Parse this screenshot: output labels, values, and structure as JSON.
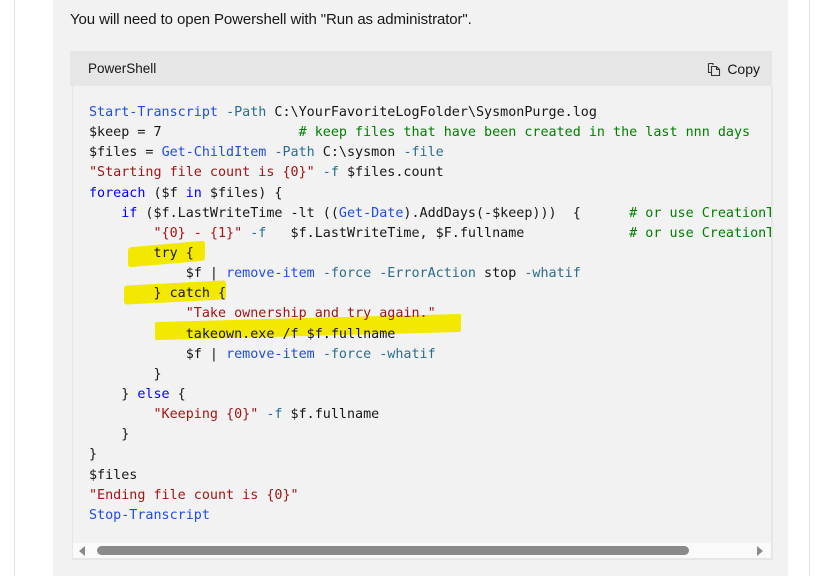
{
  "intro_text": "You will need to open Powershell with \"Run as administrator\".",
  "code_block": {
    "language": "PowerShell",
    "copy_label": "Copy",
    "copy_icon": "copy-icon",
    "lines": [
      [
        [
          "cmd",
          "Start-Transcript"
        ],
        [
          "plain",
          " "
        ],
        [
          "param",
          "-Path"
        ],
        [
          "plain",
          " C:\\YourFavoriteLogFolder\\SysmonPurge.log"
        ]
      ],
      [
        [
          "plain",
          "$keep = 7                 "
        ],
        [
          "cmt",
          "# keep files that have been created in the last nnn days"
        ]
      ],
      [
        [
          "plain",
          "$files = "
        ],
        [
          "cmd",
          "Get-ChildItem"
        ],
        [
          "plain",
          " "
        ],
        [
          "param",
          "-Path"
        ],
        [
          "plain",
          " C:\\sysmon "
        ],
        [
          "param",
          "-file"
        ]
      ],
      [
        [
          "str",
          "\"Starting file count is {0}\""
        ],
        [
          "plain",
          " "
        ],
        [
          "param",
          "-f"
        ],
        [
          "plain",
          " $files.count"
        ]
      ],
      [
        [
          "kw",
          "foreach"
        ],
        [
          "plain",
          " ($f "
        ],
        [
          "kw",
          "in"
        ],
        [
          "plain",
          " $files) {"
        ]
      ],
      [
        [
          "plain",
          "    "
        ],
        [
          "kw",
          "if"
        ],
        [
          "plain",
          " ($f.LastWriteTime -lt (("
        ],
        [
          "cmd",
          "Get-Date"
        ],
        [
          "plain",
          ").AddDays(-$keep)))  {      "
        ],
        [
          "cmt",
          "# or use CreationTime"
        ]
      ],
      [
        [
          "plain",
          "        "
        ],
        [
          "str",
          "\"{0} - {1}\""
        ],
        [
          "plain",
          " "
        ],
        [
          "param",
          "-f"
        ],
        [
          "plain",
          "   $f.LastWriteTime, $F.fullname             "
        ],
        [
          "cmt",
          "# or use CreationTime"
        ]
      ],
      [
        [
          "plain",
          "        try {"
        ]
      ],
      [
        [
          "plain",
          "            $f | "
        ],
        [
          "cmd",
          "remove-item"
        ],
        [
          "plain",
          " "
        ],
        [
          "param",
          "-force"
        ],
        [
          "plain",
          " "
        ],
        [
          "param",
          "-ErrorAction"
        ],
        [
          "plain",
          " stop "
        ],
        [
          "param",
          "-whatif"
        ]
      ],
      [
        [
          "plain",
          "        } catch {"
        ]
      ],
      [
        [
          "plain",
          "            "
        ],
        [
          "str",
          "\"Take ownership and try again.\""
        ]
      ],
      [
        [
          "plain",
          "            takeown.exe /f $f.fullname"
        ]
      ],
      [
        [
          "plain",
          "            $f | "
        ],
        [
          "cmd",
          "remove-item"
        ],
        [
          "plain",
          " "
        ],
        [
          "param",
          "-force"
        ],
        [
          "plain",
          " "
        ],
        [
          "param",
          "-whatif"
        ]
      ],
      [
        [
          "plain",
          "        }"
        ]
      ],
      [
        [
          "plain",
          "    } "
        ],
        [
          "kw",
          "else"
        ],
        [
          "plain",
          " {"
        ]
      ],
      [
        [
          "plain",
          "        "
        ],
        [
          "str",
          "\"Keeping {0}\""
        ],
        [
          "plain",
          " "
        ],
        [
          "param",
          "-f"
        ],
        [
          "plain",
          " $f.fullname"
        ]
      ],
      [
        [
          "plain",
          "    }"
        ]
      ],
      [
        [
          "plain",
          "}"
        ]
      ],
      [
        [
          "plain",
          "$files"
        ]
      ],
      [
        [
          "str",
          "\"Ending file count is {0}\""
        ]
      ],
      [
        [
          "cmd",
          "Stop-Transcript"
        ]
      ]
    ],
    "highlighted_lines": [
      7,
      9,
      11
    ],
    "highlight_color": "#f3e800"
  },
  "colors": {
    "keyword": "#0101fd",
    "cmdlet": "#1f4de6",
    "parameter": "#2b6d8c",
    "string": "#a31515",
    "comment": "#008000"
  }
}
